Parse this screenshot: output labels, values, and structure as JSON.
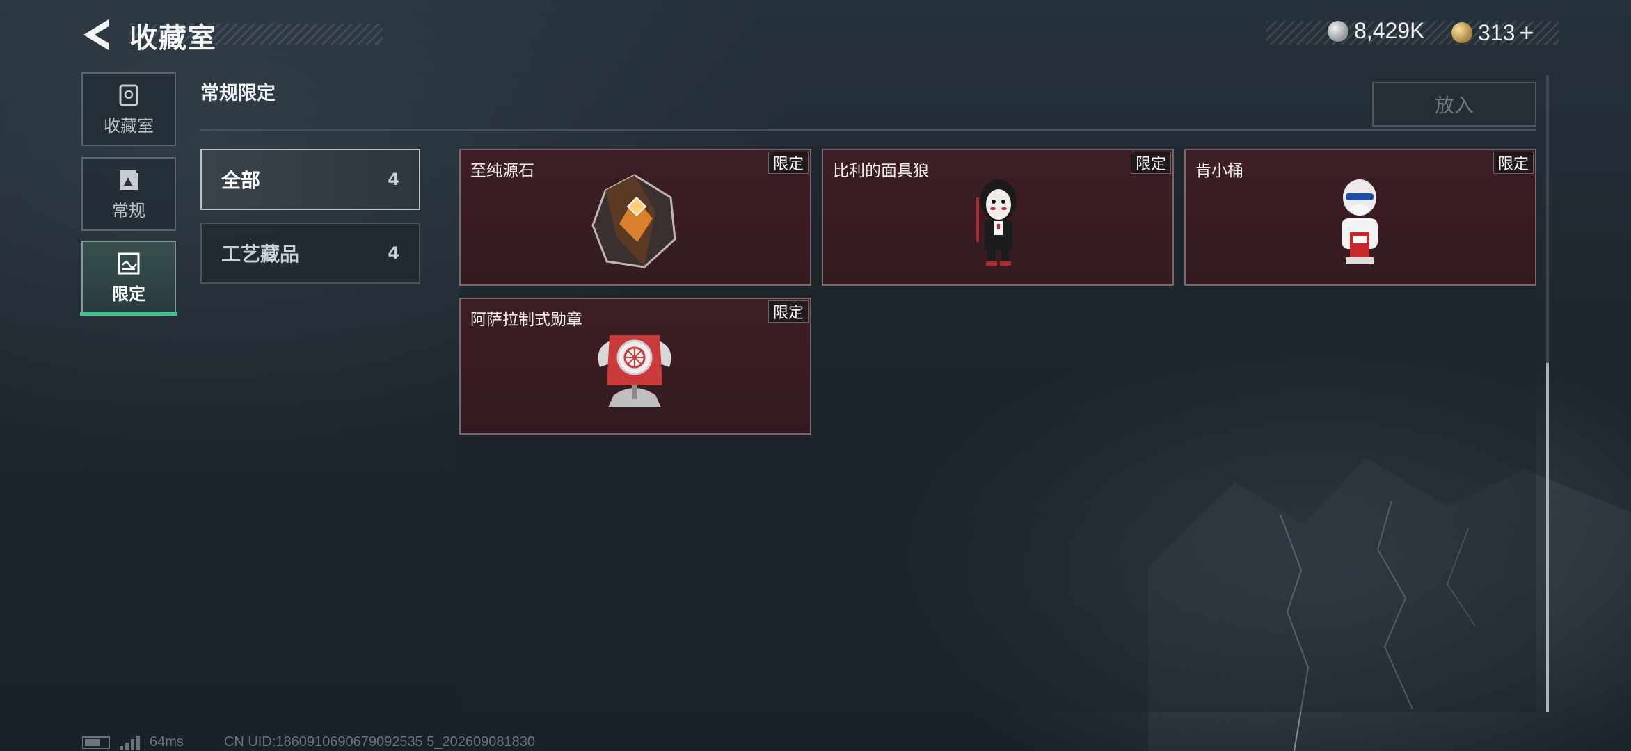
{
  "header": {
    "title": "收藏室",
    "currency": [
      {
        "icon": "silver-coin-icon",
        "value": "8,429K"
      },
      {
        "icon": "gold-coin-icon",
        "value": "313"
      }
    ],
    "add_currency_symbol": "+"
  },
  "nav": {
    "items": [
      {
        "label": "收藏室",
        "icon": "vault-icon",
        "active": false
      },
      {
        "label": "常规",
        "icon": "document-icon",
        "active": false
      },
      {
        "label": "限定",
        "icon": "picture-icon",
        "active": true
      }
    ]
  },
  "section": {
    "title": "常规限定",
    "put_in_label": "放入"
  },
  "filters": [
    {
      "label": "全部",
      "count": "4",
      "active": true
    },
    {
      "label": "工艺藏品",
      "count": "4",
      "active": false
    }
  ],
  "items": [
    {
      "name": "至纯源石",
      "tag": "限定",
      "icon": "crystal-stone-icon"
    },
    {
      "name": "比利的面具狼",
      "tag": "限定",
      "icon": "puppet-figure-icon"
    },
    {
      "name": "肯小桶",
      "tag": "限定",
      "icon": "mascot-figure-icon"
    },
    {
      "name": "阿萨拉制式勋章",
      "tag": "限定",
      "icon": "medal-icon"
    }
  ],
  "footer": {
    "ping": "64ms",
    "uid": "CN UID:1860910690679092535 5_202609081830"
  },
  "colors": {
    "accent": "#42c48a",
    "card_bg": "#3a1d23",
    "background": "#222b33"
  }
}
